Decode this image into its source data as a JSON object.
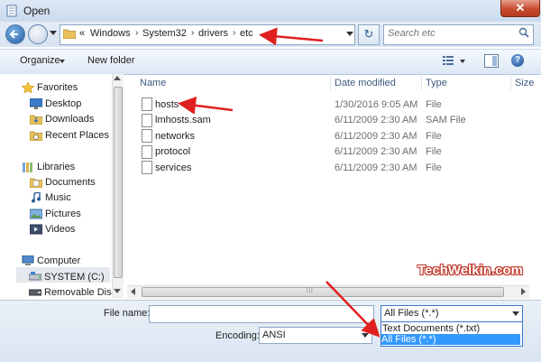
{
  "window": {
    "title": "Open",
    "close_glyph": "✕"
  },
  "address": {
    "overflow": "«",
    "crumbs": [
      "Windows",
      "System32",
      "drivers",
      "etc"
    ],
    "separator": "›",
    "refresh_glyph": "↻"
  },
  "search": {
    "placeholder": "Search etc"
  },
  "toolbar": {
    "organize_label": "Organize",
    "new_folder_label": "New folder",
    "help_glyph": "?"
  },
  "nav": {
    "favorites": "Favorites",
    "fav_items": [
      "Desktop",
      "Downloads",
      "Recent Places"
    ],
    "libraries": "Libraries",
    "lib_items": [
      "Documents",
      "Music",
      "Pictures",
      "Videos"
    ],
    "computer": "Computer",
    "comp_items": [
      "SYSTEM (C:)",
      "Removable Disk ("
    ]
  },
  "columns": {
    "name": "Name",
    "date": "Date modified",
    "type": "Type",
    "size": "Size"
  },
  "files": [
    {
      "name": "hosts",
      "date": "1/30/2016 9:05 AM",
      "type": "File"
    },
    {
      "name": "lmhosts.sam",
      "date": "6/11/2009 2:30 AM",
      "type": "SAM File"
    },
    {
      "name": "networks",
      "date": "6/11/2009 2:30 AM",
      "type": "File"
    },
    {
      "name": "protocol",
      "date": "6/11/2009 2:30 AM",
      "type": "File"
    },
    {
      "name": "services",
      "date": "6/11/2009 2:30 AM",
      "type": "File"
    }
  ],
  "bottom": {
    "filename_label": "File name:",
    "filename_value": "",
    "filetype_value": "All Files  (*.*)",
    "filetype_options": [
      "Text Documents (*.txt)",
      "All Files  (*.*)"
    ],
    "encoding_label": "Encoding:",
    "encoding_value": "ANSI"
  },
  "watermark": "TechWelkin.com",
  "colors": {
    "annotation_red": "#e02020",
    "selection_blue": "#3399ff"
  }
}
